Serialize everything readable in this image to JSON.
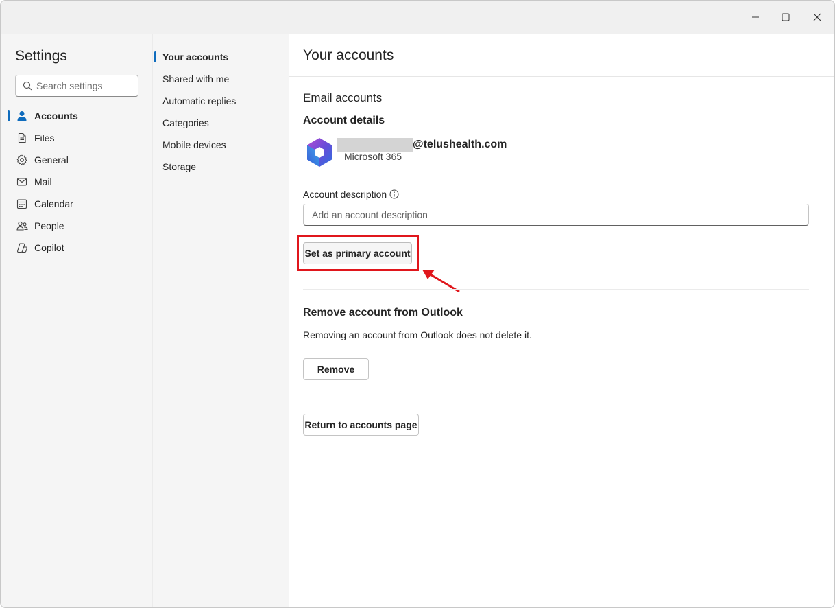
{
  "window": {
    "controls": {
      "minimize": "minimize-icon",
      "maximize": "maximize-icon",
      "close": "close-icon"
    }
  },
  "nav": {
    "title": "Settings",
    "search_placeholder": "Search settings",
    "items": [
      {
        "label": "Accounts",
        "icon": "person-icon",
        "active": true
      },
      {
        "label": "Files",
        "icon": "file-icon",
        "active": false
      },
      {
        "label": "General",
        "icon": "gear-icon",
        "active": false
      },
      {
        "label": "Mail",
        "icon": "mail-icon",
        "active": false
      },
      {
        "label": "Calendar",
        "icon": "calendar-icon",
        "active": false
      },
      {
        "label": "People",
        "icon": "people-icon",
        "active": false
      },
      {
        "label": "Copilot",
        "icon": "copilot-icon",
        "active": false
      }
    ]
  },
  "subnav": {
    "items": [
      {
        "label": "Your accounts",
        "active": true
      },
      {
        "label": "Shared with me",
        "active": false
      },
      {
        "label": "Automatic replies",
        "active": false
      },
      {
        "label": "Categories",
        "active": false
      },
      {
        "label": "Mobile devices",
        "active": false
      },
      {
        "label": "Storage",
        "active": false
      }
    ]
  },
  "main": {
    "title": "Your accounts",
    "section_title": "Email accounts",
    "details_title": "Account details",
    "account": {
      "email_domain": "@telushealth.com",
      "type": "Microsoft 365",
      "logo": "microsoft-365-icon"
    },
    "description": {
      "label": "Account description",
      "placeholder": "Add an account description"
    },
    "set_primary_label": "Set as primary account",
    "remove": {
      "title": "Remove account from Outlook",
      "text": "Removing an account from Outlook does not delete it.",
      "button_label": "Remove"
    },
    "return_label": "Return to accounts page"
  },
  "colors": {
    "accent": "#0f6cbd",
    "annotation": "#e0161c"
  }
}
